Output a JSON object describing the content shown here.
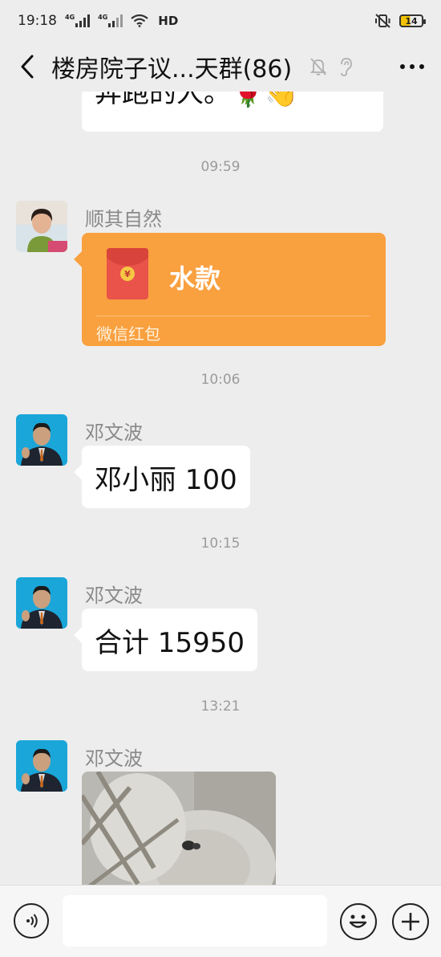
{
  "status_bar": {
    "time": "19:18",
    "signal_1_label": "4G",
    "signal_2_label": "4G",
    "network": "HD",
    "battery": "14",
    "icons": [
      "signal-icon",
      "wifi-icon",
      "mute-vibrate-icon",
      "battery-icon"
    ]
  },
  "header": {
    "title": "楼房院子议...天群(86)",
    "icons": [
      "back-icon",
      "mute-bell-icon",
      "ear-icon",
      "more-icon"
    ]
  },
  "messages": {
    "top_partial_text": "奔跑的人。🌹👋",
    "time_1": "09:59",
    "msg_1": {
      "sender": "顺其自然",
      "packet_text": "水款",
      "packet_label": "微信红包"
    },
    "time_2": "10:06",
    "msg_2": {
      "sender": "邓文波",
      "text": "邓小丽 100"
    },
    "time_3": "10:15",
    "msg_3": {
      "sender": "邓文波",
      "text": "合计 15950"
    },
    "time_4": "13:21",
    "msg_4": {
      "sender": "邓文波"
    }
  },
  "input_bar": {
    "message_value": "",
    "icons": [
      "voice-icon",
      "emoji-icon",
      "plus-icon"
    ]
  },
  "colors": {
    "background": "#ededed",
    "bubble": "#ffffff",
    "red_packet": "#f9a03f",
    "envelope": "#e9534a",
    "timestamp": "#9b9b9b"
  }
}
